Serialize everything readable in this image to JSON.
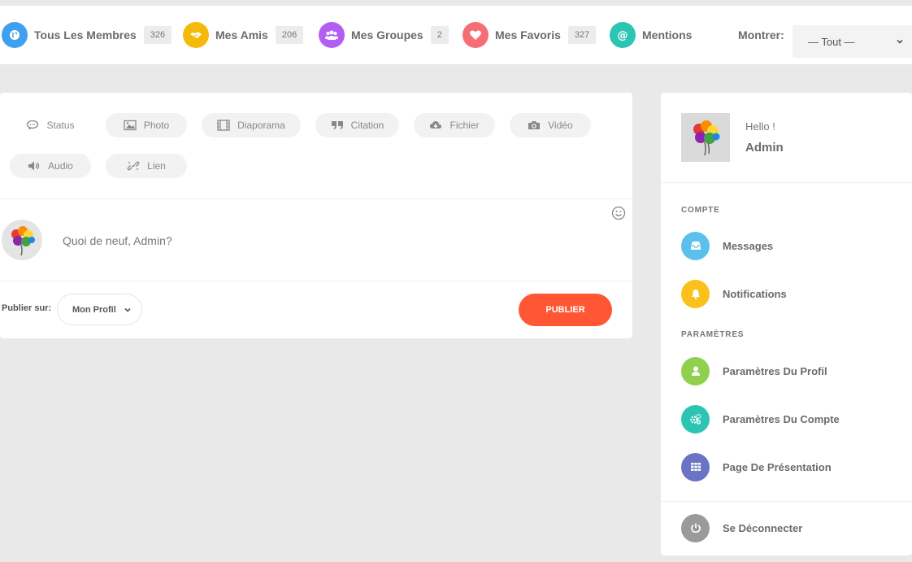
{
  "nav": {
    "items": [
      {
        "label": "Tous Les Membres",
        "count": "326",
        "icon": "globe-icon",
        "color": "#3fa0f0"
      },
      {
        "label": "Mes Amis",
        "count": "206",
        "icon": "handshake-icon",
        "color": "#f5b90a"
      },
      {
        "label": "Mes Groupes",
        "count": "2",
        "icon": "group-icon",
        "color": "#b25ef3"
      },
      {
        "label": "Mes Favoris",
        "count": "327",
        "icon": "heart-icon",
        "color": "#f56e75"
      },
      {
        "label": "Mentions",
        "icon": "at-icon",
        "color": "#2cc5b4"
      }
    ],
    "show_label": "Montrer:",
    "show_value": "— Tout —"
  },
  "composer": {
    "types": [
      {
        "label": "Status",
        "icon": "chat-icon"
      },
      {
        "label": "Photo",
        "icon": "image-icon"
      },
      {
        "label": "Diaporama",
        "icon": "film-icon"
      },
      {
        "label": "Citation",
        "icon": "quote-icon"
      },
      {
        "label": "Fichier",
        "icon": "cloud-download-icon"
      },
      {
        "label": "Vidéo",
        "icon": "camera-icon"
      },
      {
        "label": "Audio",
        "icon": "speaker-icon"
      },
      {
        "label": "Lien",
        "icon": "link-icon"
      }
    ],
    "placeholder": "Quoi de neuf, Admin?",
    "publish_on_label": "Publier sur:",
    "publish_on_value": "Mon Profil",
    "publish_button": "PUBLIER"
  },
  "sidebar": {
    "hello": "Hello !",
    "username": "Admin",
    "account_title": "COMPTE",
    "settings_title": "PARAMÈTRES",
    "account_items": [
      {
        "label": "Messages",
        "icon": "inbox-icon",
        "color": "#5bc0eb"
      },
      {
        "label": "Notifications",
        "icon": "bell-icon",
        "color": "#fbc11b"
      }
    ],
    "settings_items": [
      {
        "label": "Paramètres Du Profil",
        "icon": "user-icon",
        "color": "#8fd14f"
      },
      {
        "label": "Paramètres Du Compte",
        "icon": "gears-icon",
        "color": "#2cc5b4"
      },
      {
        "label": "Page De Présentation",
        "icon": "grid-icon",
        "color": "#6b73c4"
      }
    ],
    "logout": {
      "label": "Se Déconnecter",
      "icon": "power-icon",
      "color": "#9a9a9a"
    }
  }
}
